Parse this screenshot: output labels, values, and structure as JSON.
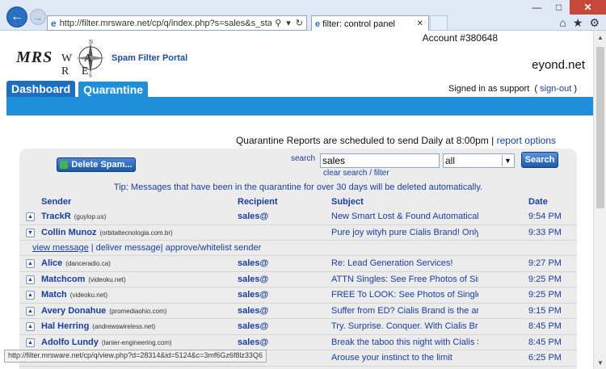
{
  "browser": {
    "url": "http://filter.mrsware.net/cp/q/index.php?s=sales&s_status=&m=&m=",
    "tab_title": "filter: control panel",
    "back_icon": "back-arrow-icon",
    "forward_icon": "forward-arrow-icon"
  },
  "header": {
    "account": "Account #380648",
    "logo_mrs": "MRS",
    "logo_ware": "W A R E",
    "logo_subtitle": "Spam Filter Portal",
    "domain": "eyond.net",
    "signed_in_prefix": "Signed in as support",
    "signout": "sign-out"
  },
  "tabs": [
    {
      "label": "Dashboard"
    },
    {
      "label": "Quarantine",
      "active": true
    }
  ],
  "schedule": {
    "text": "Quarantine Reports are scheduled to send Daily at 8:00pm |",
    "link": "report options"
  },
  "controls": {
    "delete_label": "Delete Spam...",
    "search_label": "search",
    "search_value": "sales",
    "filter_value": "all",
    "search_button": "Search",
    "clear_link": "clear search / filter"
  },
  "tip": "Tip: Messages that have been in the quarantine for over 30 days will be deleted automatically.",
  "columns": {
    "sender": "Sender",
    "recipient": "Recipient",
    "subject": "Subject",
    "date": "Date"
  },
  "rows": [
    {
      "name": "TrackR",
      "domain": "(guylop.us)",
      "recipient": "sales@",
      "subject": "New Smart Lost & Found Automatically Find",
      "date": "9:54 PM"
    },
    {
      "name": "Collin Munoz",
      "domain": "(orbitaltecnologia.com.br)",
      "recipient": "",
      "subject": "Pure joy wityh pure Cialis Brand! Only at ou",
      "date": "9:33 PM",
      "expanded": true
    },
    {
      "name": "Alice",
      "domain": "(danceradio.ca)",
      "recipient": "sales@",
      "subject": "Re: Lead Generation Services!",
      "date": "9:27 PM"
    },
    {
      "name": "Matchcom",
      "domain": "(videoku.net)",
      "recipient": "sales@",
      "subject": "ATTN Singles: See Free Photos of Singles I",
      "date": "9:25 PM"
    },
    {
      "name": "Match",
      "domain": "(videoku.net)",
      "recipient": "sales@",
      "subject": "FREE To LOOK: See Photos of Singles In Y",
      "date": "9:25 PM"
    },
    {
      "name": "Avery Donahue",
      "domain": "(promediaohio.com)",
      "recipient": "sales@",
      "subject": "Suffer from ED? Cialis Brand is the answer!",
      "date": "9:15 PM"
    },
    {
      "name": "Hal Herring",
      "domain": "(andrewswireless.net)",
      "recipient": "sales@",
      "subject": "Try. Surprise. Conquer. With Cialis Brand.",
      "date": "8:45 PM"
    },
    {
      "name": "Adolfo Lundy",
      "domain": "(lanier-engineering.com)",
      "recipient": "sales@",
      "subject": "Break the taboo this night with Cialis Soft.",
      "date": "8:45 PM"
    },
    {
      "name": "",
      "domain": "",
      "recipient": "",
      "subject": "Arouse your instinct to the limit",
      "date": "6:25 PM"
    }
  ],
  "row_actions": {
    "view": "view message",
    "deliver": " | deliver message",
    "approve": "| approve/whitelist sender"
  },
  "statusbar": "http://filter.mrsware.net/cp/q/view.php?d=28314&id=5124&c=3mf6Gz6f8lz33Q6"
}
